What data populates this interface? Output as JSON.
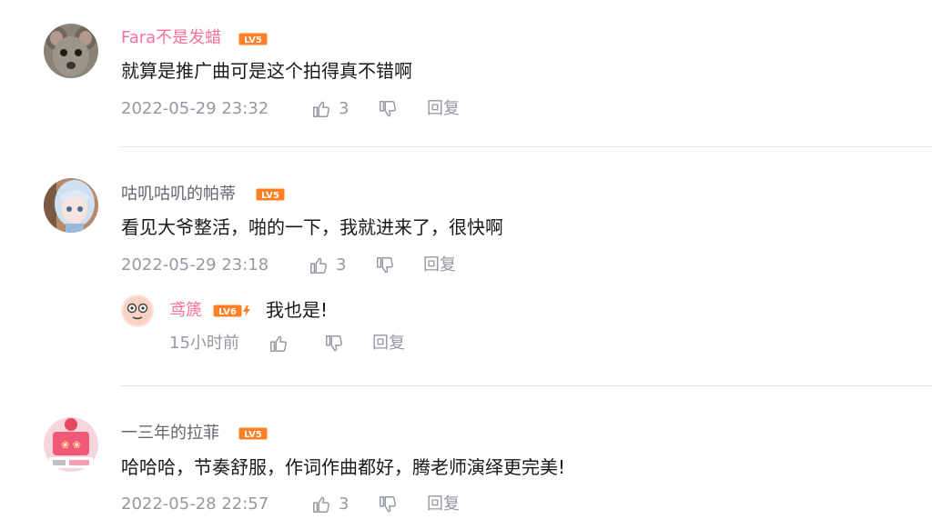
{
  "colors": {
    "accent_pink": "#fb7299",
    "level_orange": "#ff7f24",
    "text_main": "#18191c",
    "text_meta": "#9499a0",
    "divider": "#e3e5e7"
  },
  "comments": [
    {
      "username": "Fara不是发蜡",
      "level": "LV5",
      "content": "就算是推广曲可是这个拍得真不错啊",
      "time": "2022-05-29 23:32",
      "likes": "3",
      "reply_label": "回复",
      "avatar_icon": "mouse-avatar-icon"
    },
    {
      "username": "咕叽咕叽的帕蒂",
      "level": "LV5",
      "content": "看见大爷整活，啪的一下，我就进来了，很快啊",
      "time": "2022-05-29 23:18",
      "likes": "3",
      "reply_label": "回复",
      "avatar_icon": "anime-girl-avatar-icon",
      "replies": [
        {
          "username": "鸢篪",
          "level": "LV6",
          "content": "我也是!",
          "time": "15小时前",
          "reply_label": "回复",
          "avatar_icon": "cartoon-face-avatar-icon"
        }
      ]
    },
    {
      "username": "一三年的拉菲",
      "level": "LV5",
      "content": "哈哈哈，节奏舒服，作词作曲都好，腾老师演绎更完美!",
      "time": "2022-05-28 22:57",
      "likes": "3",
      "reply_label": "回复",
      "avatar_icon": "festive-poster-avatar-icon"
    }
  ]
}
